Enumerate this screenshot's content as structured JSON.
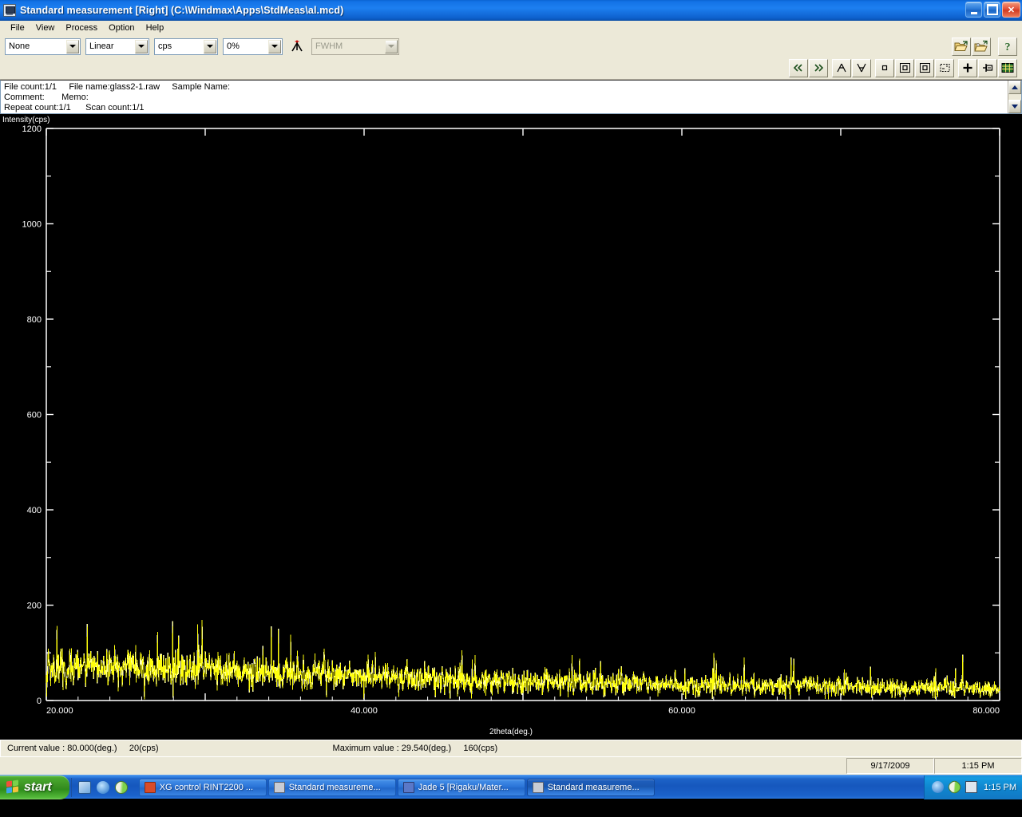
{
  "window": {
    "title": "Standard measurement [Right]  (C:\\Windmax\\Apps\\StdMeas\\al.mcd)",
    "icon": "measurement-app-icon",
    "minimize_label": "Minimize",
    "maximize_label": "Restore",
    "close_label": "Close"
  },
  "menu": {
    "items": [
      {
        "label": "File"
      },
      {
        "label": "View"
      },
      {
        "label": "Process"
      },
      {
        "label": "Option"
      },
      {
        "label": "Help"
      }
    ]
  },
  "toolbar": {
    "combos": [
      {
        "name": "smoothing-select",
        "value": "None",
        "disabled": false
      },
      {
        "name": "scale-select",
        "value": "Linear",
        "disabled": false
      },
      {
        "name": "unit-select",
        "value": "cps",
        "disabled": false
      },
      {
        "name": "percent-select",
        "value": "0%",
        "disabled": false
      },
      {
        "name": "fwhm-select",
        "value": "FWHM",
        "disabled": true
      }
    ],
    "peak_button": {
      "name": "peak-search-button",
      "icon": "peak-icon"
    },
    "file_buttons": [
      {
        "name": "open-file-button",
        "icon": "open-folder-icon"
      },
      {
        "name": "open-overlay-button",
        "icon": "open-folder-star-icon"
      },
      {
        "name": "help-button",
        "icon": "question-mark-icon"
      }
    ],
    "nav_buttons": [
      {
        "name": "scroll-left-button",
        "icon": "double-chevron-left-icon"
      },
      {
        "name": "scroll-right-button",
        "icon": "double-chevron-right-icon"
      },
      {
        "name": "peak-up-button",
        "icon": "peak-up-icon"
      },
      {
        "name": "peak-down-button",
        "icon": "peak-down-icon"
      },
      {
        "name": "zoom-fit-button",
        "icon": "small-square-icon"
      },
      {
        "name": "zoom-box-button",
        "icon": "framed-square-icon"
      },
      {
        "name": "zoom-select-button",
        "icon": "framed-square-active-icon"
      },
      {
        "name": "marquee-button",
        "icon": "dashed-box-icon"
      },
      {
        "name": "crosshair-button",
        "icon": "plus-icon"
      },
      {
        "name": "flag-marker-button",
        "icon": "flag-marker-icon"
      },
      {
        "name": "data-table-button",
        "icon": "grid-table-icon"
      }
    ]
  },
  "info_panel": {
    "line1": "File count:1/1     File name:glass2-1.raw     Sample Name:",
    "line2": "Comment:       Memo:",
    "line3": "Repeat count:1/1      Scan count:1/1",
    "scroll_up": "scroll-up-arrow",
    "scroll_down": "scroll-down-arrow"
  },
  "status_bar": {
    "current_value": "Current value : 80.000(deg.)     20(cps)",
    "maximum_value": "Maximum value : 29.540(deg.)     160(cps)"
  },
  "status_bar2": {
    "date": "9/17/2009",
    "time": "1:15 PM"
  },
  "taskbar": {
    "start_label": "start",
    "quick_launch": [
      {
        "name": "show-desktop-icon"
      },
      {
        "name": "internet-explorer-icon"
      },
      {
        "name": "media-player-icon"
      }
    ],
    "tasks": [
      {
        "name": "taskbar-item-xg-control",
        "label": "XG control RINT2200 ...",
        "active": false,
        "icon_color": "#d84c2a"
      },
      {
        "name": "taskbar-item-standard-measurement-1",
        "label": "Standard measureme...",
        "active": false,
        "icon_color": "#c9ccd4"
      },
      {
        "name": "taskbar-item-jade5",
        "label": "Jade 5 [Rigaku/Mater...",
        "active": false,
        "icon_color": "#5a78c8"
      },
      {
        "name": "taskbar-item-standard-measurement-2",
        "label": "Standard measureme...",
        "active": true,
        "icon_color": "#c9ccd4"
      }
    ],
    "tray_icons": [
      {
        "name": "network-shield-icon"
      },
      {
        "name": "media-pill-icon"
      },
      {
        "name": "measurement-tray-icon"
      }
    ],
    "clock": "1:15 PM"
  },
  "colors": {
    "trace": "#ffff00",
    "trace_highlight": "#ffffff",
    "plot_background": "#000000",
    "axis": "#ffffff",
    "title_bar": "#1d7ff0",
    "toolbar_bg": "#ece9d8"
  },
  "chart_data": {
    "type": "line",
    "title": "",
    "xlabel": "2theta(deg.)",
    "ylabel": "Intensity(cps)",
    "xlim": [
      20.0,
      80.0
    ],
    "ylim": [
      0,
      1200
    ],
    "xticks": [
      20.0,
      40.0,
      60.0,
      80.0
    ],
    "xtick_labels": [
      "20.000",
      "40.000",
      "60.000",
      "80.000"
    ],
    "yticks": [
      0,
      200,
      400,
      600,
      800,
      1000,
      1200
    ],
    "ytick_labels": [
      "0",
      "200",
      "400",
      "600",
      "800",
      "1000",
      "1200"
    ],
    "yminor_step": 100,
    "grid": false,
    "legend": null,
    "series": [
      {
        "name": "glass2-1.raw",
        "color": "#ffff00",
        "description": "Amorphous glass XRD scan: broad low-intensity noise band, mean counts falling from about 70 cps near 20 deg to about 25 cps near 80 deg, with random spikes up to 160 cps.",
        "baseline_points": [
          {
            "x": 20.0,
            "y": 72
          },
          {
            "x": 25.0,
            "y": 70
          },
          {
            "x": 30.0,
            "y": 66
          },
          {
            "x": 35.0,
            "y": 58
          },
          {
            "x": 40.0,
            "y": 50
          },
          {
            "x": 45.0,
            "y": 44
          },
          {
            "x": 50.0,
            "y": 40
          },
          {
            "x": 55.0,
            "y": 37
          },
          {
            "x": 60.0,
            "y": 34
          },
          {
            "x": 65.0,
            "y": 31
          },
          {
            "x": 70.0,
            "y": 29
          },
          {
            "x": 75.0,
            "y": 27
          },
          {
            "x": 80.0,
            "y": 25
          }
        ],
        "noise_amplitude_points": [
          {
            "x": 20.0,
            "y": 40
          },
          {
            "x": 30.0,
            "y": 38
          },
          {
            "x": 40.0,
            "y": 32
          },
          {
            "x": 50.0,
            "y": 28
          },
          {
            "x": 60.0,
            "y": 25
          },
          {
            "x": 70.0,
            "y": 22
          },
          {
            "x": 80.0,
            "y": 20
          }
        ],
        "max_point": {
          "x": 29.54,
          "y": 160
        },
        "current_point": {
          "x": 80.0,
          "y": 20
        }
      }
    ]
  }
}
